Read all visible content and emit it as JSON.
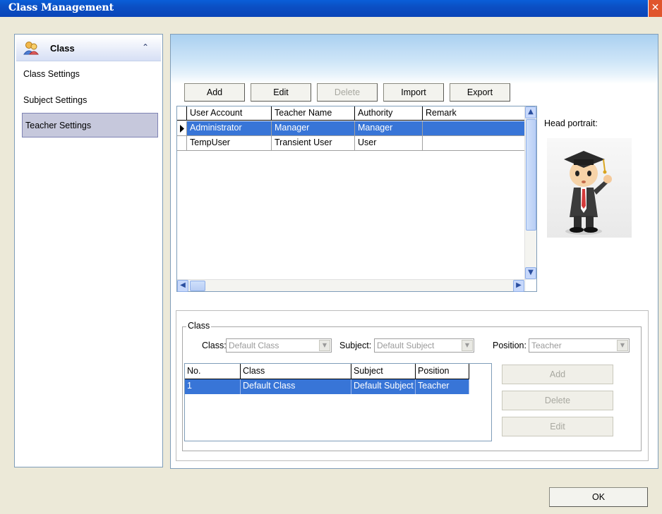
{
  "window": {
    "title": "Class Management",
    "close_glyph": "✕"
  },
  "sidebar": {
    "group_title": "Class",
    "collapse_glyph": "⌃",
    "items": [
      {
        "label": "Class Settings"
      },
      {
        "label": "Subject Settings"
      },
      {
        "label": "Teacher Settings",
        "selected": true
      }
    ]
  },
  "toolbar": {
    "add": "Add",
    "edit": "Edit",
    "delete": "Delete",
    "import": "Import",
    "export": "Export"
  },
  "users_table": {
    "columns": [
      "User Account",
      "Teacher Name",
      "Authority",
      "Remark"
    ],
    "rows": [
      {
        "account": "Administrator",
        "name": "Manager",
        "authority": "Manager",
        "remark": "",
        "selected": true
      },
      {
        "account": "TempUser",
        "name": "Transient User",
        "authority": "User",
        "remark": ""
      }
    ]
  },
  "portrait": {
    "label": "Head portrait:",
    "icon": "graduate-cartoon-icon"
  },
  "class_group": {
    "legend": "Class",
    "class_label": "Class:",
    "class_value": "Default Class",
    "subject_label": "Subject:",
    "subject_value": "Default Subject",
    "position_label": "Position:",
    "position_value": "Teacher",
    "table": {
      "columns": [
        "No.",
        "Class",
        "Subject",
        "Position"
      ],
      "rows": [
        {
          "no": "1",
          "class": "Default Class",
          "subject": "Default Subject",
          "position": "Teacher"
        }
      ]
    },
    "add": "Add",
    "delete": "Delete",
    "edit": "Edit"
  },
  "footer": {
    "ok": "OK"
  },
  "colors": {
    "selection": "#3875d7",
    "titlebar": "#0a5fd8"
  }
}
